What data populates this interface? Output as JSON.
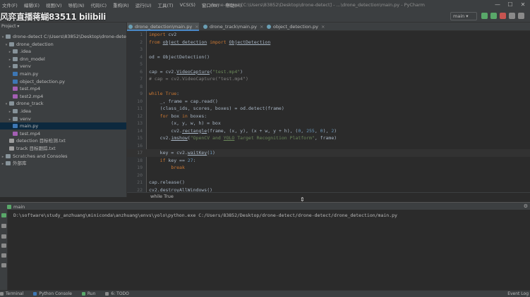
{
  "menu": {
    "items": [
      "文件(F)",
      "编辑(E)",
      "视图(V)",
      "导航(N)",
      "代码(C)",
      "重构(R)",
      "运行(U)",
      "工具(T)",
      "VCS(S)",
      "窗口(W)",
      "帮助(H)"
    ],
    "window_title": "drone-detect [C:\\Users\\83852\\Desktop\\drone-detect] - ...\\drone_detection\\main.py - PyCharm",
    "minimize": "—",
    "maximize": "☐",
    "close": "✕"
  },
  "watermark": "风弈直播蒋蝴83511 bilibili",
  "toolbar": {
    "branch": "main ▾"
  },
  "project": {
    "label": "Project ▾"
  },
  "tabs": [
    {
      "label": "drone_detection\\main.py",
      "close": "×"
    },
    {
      "label": "drone_track\\main.py",
      "close": "×"
    },
    {
      "label": "object_detection.py",
      "close": "×"
    }
  ],
  "tree": [
    {
      "arrow": "▾",
      "icon": "folder",
      "label": "drone-detect  C:\\Users\\83852\\Desktop\\drone-detect",
      "indent": 0
    },
    {
      "arrow": "▾",
      "icon": "folder",
      "label": "drone_detection",
      "indent": 1
    },
    {
      "arrow": "▸",
      "icon": "folder",
      "label": ".idea",
      "indent": 2
    },
    {
      "arrow": "▸",
      "icon": "folder",
      "label": "dnn_model",
      "indent": 2
    },
    {
      "arrow": "▸",
      "icon": "folder",
      "label": "venv",
      "indent": 2
    },
    {
      "arrow": "",
      "icon": "py",
      "label": "main.py",
      "indent": 2
    },
    {
      "arrow": "",
      "icon": "py",
      "label": "object_detection.py",
      "indent": 2
    },
    {
      "arrow": "",
      "icon": "mp4",
      "label": "test.mp4",
      "indent": 2
    },
    {
      "arrow": "",
      "icon": "mp4",
      "label": "test2.mp4",
      "indent": 2
    },
    {
      "arrow": "▾",
      "icon": "folder",
      "label": "drone_track",
      "indent": 1
    },
    {
      "arrow": "▸",
      "icon": "folder",
      "label": ".idea",
      "indent": 2
    },
    {
      "arrow": "▸",
      "icon": "folder",
      "label": "venv",
      "indent": 2
    },
    {
      "arrow": "",
      "icon": "py",
      "label": "main.py",
      "indent": 2,
      "selected": true
    },
    {
      "arrow": "",
      "icon": "mp4",
      "label": "test.mp4",
      "indent": 2
    },
    {
      "arrow": "",
      "icon": "txt",
      "label": "detection  目标检测.txt",
      "indent": 1
    },
    {
      "arrow": "",
      "icon": "txt",
      "label": "track  目标跟踪.txt",
      "indent": 1
    },
    {
      "arrow": "▸",
      "icon": "folder",
      "label": "Scratches and Consoles",
      "indent": 0
    },
    {
      "arrow": "▸",
      "icon": "folder",
      "label": "外部库",
      "indent": 0
    }
  ],
  "code_lines": [
    {
      "n": "1",
      "html": "<span class=\"kw\">import</span> cv2"
    },
    {
      "n": "2",
      "html": "<span class=\"kw\">from</span> <span class=\"ul\">object_detection</span> <span class=\"kw\">import</span> <span class=\"ul\">ObjectDetection</span>"
    },
    {
      "n": "3",
      "html": ""
    },
    {
      "n": "4",
      "html": "od = ObjectDetection()"
    },
    {
      "n": "5",
      "html": ""
    },
    {
      "n": "6",
      "html": "cap = cv2.<span class=\"ul\">VideoCapture</span>(<span class=\"st\">\"test.mp4\"</span>)"
    },
    {
      "n": "7",
      "html": "<span style=\"color:#808080\"># cap = cv2.VideoCapture(\"test.mp4\")</span>"
    },
    {
      "n": "8",
      "html": ""
    },
    {
      "n": "9",
      "html": "<span class=\"kw\">while</span> <span class=\"kw\">True</span>:"
    },
    {
      "n": "10",
      "html": "    _, frame = cap.read()"
    },
    {
      "n": "11",
      "html": "    (class_ids, scores, boxes) = od.detect(frame)"
    },
    {
      "n": "12",
      "html": "    <span class=\"kw\">for</span> box <span class=\"kw\">in</span> boxes:"
    },
    {
      "n": "13",
      "html": "        (x, y, w, h) = box"
    },
    {
      "n": "14",
      "html": "        cv2.<span class=\"ul\">rectangle</span>(frame, (x, y), (x + w, y + h), (<span class=\"nm\">0</span>, <span class=\"nm\">255</span>, <span class=\"nm\">0</span>), <span class=\"nm\">2</span>)"
    },
    {
      "n": "15",
      "html": "    cv2.<span class=\"ul\">imshow</span>(<span class=\"st\">\"OpenCV and <u>YOLO</u> Target Recognition Platform\"</span>, frame)"
    },
    {
      "n": "16",
      "html": ""
    },
    {
      "n": "17",
      "html": "    key = cv2.<span class=\"ul\">waitKey</span>(<span class=\"nm\">1</span>)",
      "current": true
    },
    {
      "n": "18",
      "html": "    <span class=\"kw\">if</span> key == <span class=\"nm\">27</span>:"
    },
    {
      "n": "19",
      "html": "        <span class=\"kw\">break</span>"
    },
    {
      "n": "20",
      "html": ""
    },
    {
      "n": "21",
      "html": "cap.release()"
    },
    {
      "n": "22",
      "html": "cv2.<span class=\"ul\">destroyAllWindows</span>()"
    }
  ],
  "breadcrumb": "while True",
  "run": {
    "tab_label": "main",
    "gear": "⚙",
    "command": "D:\\software\\study_anzhuang\\miniconda\\anzhuang\\envs\\yolo\\python.exe C:/Users/83852/Desktop/drone-detect/drone-detect/drone_detection/main.py"
  },
  "bottom": {
    "items": [
      "Terminal",
      "Python Console",
      "Run",
      "6: TODO"
    ],
    "event_log": "Event Log"
  },
  "colors": {
    "accent": "#4a88c7",
    "selection": "#0d293e",
    "run_green": "#59a869"
  }
}
